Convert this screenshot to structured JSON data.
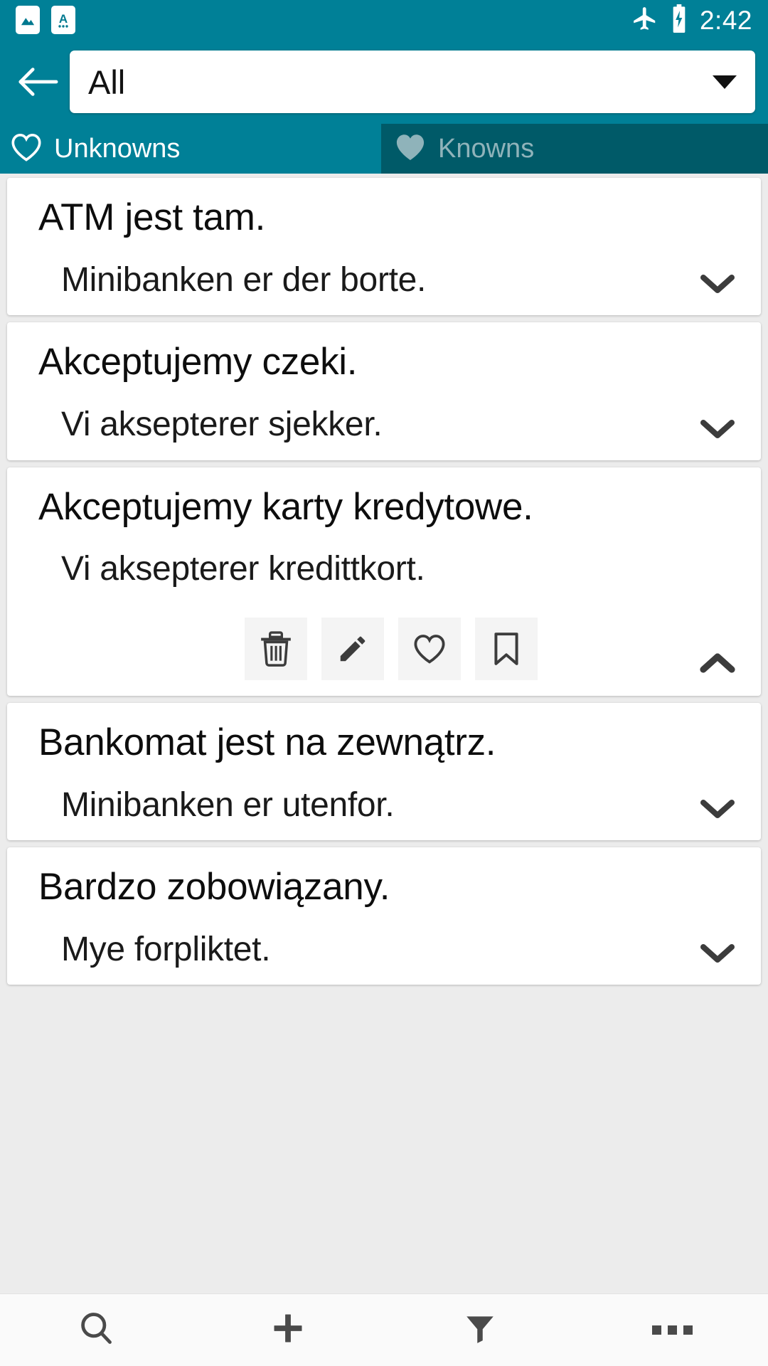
{
  "status_bar": {
    "notifications": [
      {
        "name": "image-notification-icon",
        "glyph": "image"
      },
      {
        "name": "text-notification-icon",
        "glyph": "A"
      }
    ],
    "airplane_icon": "airplane-mode-icon",
    "battery_icon": "battery-charging-icon",
    "time": "2:42"
  },
  "toolbar": {
    "back_label": "back-arrow",
    "spinner_value": "All",
    "spinner_caret": "dropdown-caret"
  },
  "tabs": [
    {
      "label": "Unknowns",
      "icon": "heart-outline-icon",
      "active": true
    },
    {
      "label": "Knowns",
      "icon": "heart-filled-icon",
      "active": false
    }
  ],
  "cards": [
    {
      "front": "ATM jest tam.",
      "back": "Minibanken er der borte.",
      "expanded": false,
      "chevron": "chevron-down-icon"
    },
    {
      "front": "Akceptujemy czeki.",
      "back": "Vi aksepterer sjekker.",
      "expanded": false,
      "chevron": "chevron-down-icon"
    },
    {
      "front": "Akceptujemy karty kredytowe.",
      "back": "Vi aksepterer kredittkort.",
      "expanded": true,
      "chevron": "chevron-up-icon",
      "actions": [
        {
          "name": "delete-button",
          "icon": "trash-icon"
        },
        {
          "name": "edit-button",
          "icon": "pencil-icon"
        },
        {
          "name": "favorite-button",
          "icon": "heart-outline-icon"
        },
        {
          "name": "bookmark-button",
          "icon": "bookmark-icon"
        }
      ]
    },
    {
      "front": "Bankomat jest na zewnątrz.",
      "back": "Minibanken er utenfor.",
      "expanded": false,
      "chevron": "chevron-down-icon"
    },
    {
      "front": "Bardzo zobowiązany.",
      "back": "Mye forpliktet.",
      "expanded": false,
      "chevron": "chevron-down-icon"
    }
  ],
  "bottom_nav": [
    {
      "name": "search-button",
      "icon": "search-icon"
    },
    {
      "name": "add-button",
      "icon": "plus-icon"
    },
    {
      "name": "filter-button",
      "icon": "filter-icon"
    },
    {
      "name": "overflow-button",
      "icon": "more-icon"
    }
  ],
  "colors": {
    "accent": "#008097",
    "accent_dark": "#005a68",
    "list_bg": "#ececec",
    "card_bg": "#ffffff",
    "icon_dark": "#3c3c3c"
  }
}
